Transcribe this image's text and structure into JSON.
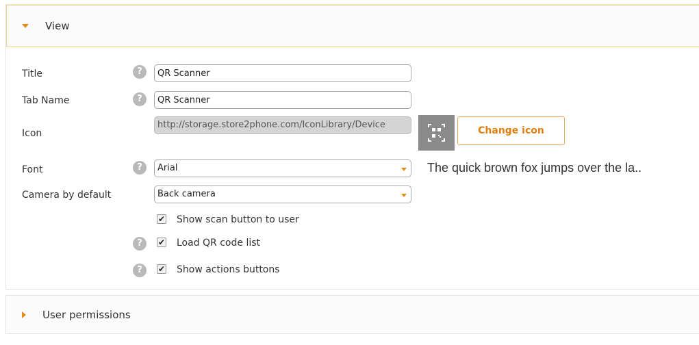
{
  "view_panel": {
    "title": "View",
    "fields": {
      "title": {
        "label": "Title",
        "value": "QR Scanner"
      },
      "tab_name": {
        "label": "Tab Name",
        "value": "QR Scanner"
      },
      "icon": {
        "label": "Icon",
        "value": "http://storage.store2phone.com/IconLibrary/Device"
      },
      "font": {
        "label": "Font",
        "value": "Arial"
      },
      "camera": {
        "label": "Camera by default",
        "value": "Back camera"
      }
    },
    "change_icon_label": "Change icon",
    "font_preview": "The quick brown fox jumps over the la..",
    "checkboxes": [
      {
        "label": "Show scan button to user",
        "checked": true
      },
      {
        "label": "Load QR code list",
        "checked": true
      },
      {
        "label": "Show actions buttons",
        "checked": true
      }
    ],
    "help_glyph": "?",
    "check_glyph": "✔"
  },
  "permissions_panel": {
    "title": "User permissions"
  },
  "colors": {
    "accent": "#e58a19",
    "header_border": "#f1d28a",
    "help_icon": "#b9b9b9",
    "icon_box": "#8a8a8a"
  }
}
